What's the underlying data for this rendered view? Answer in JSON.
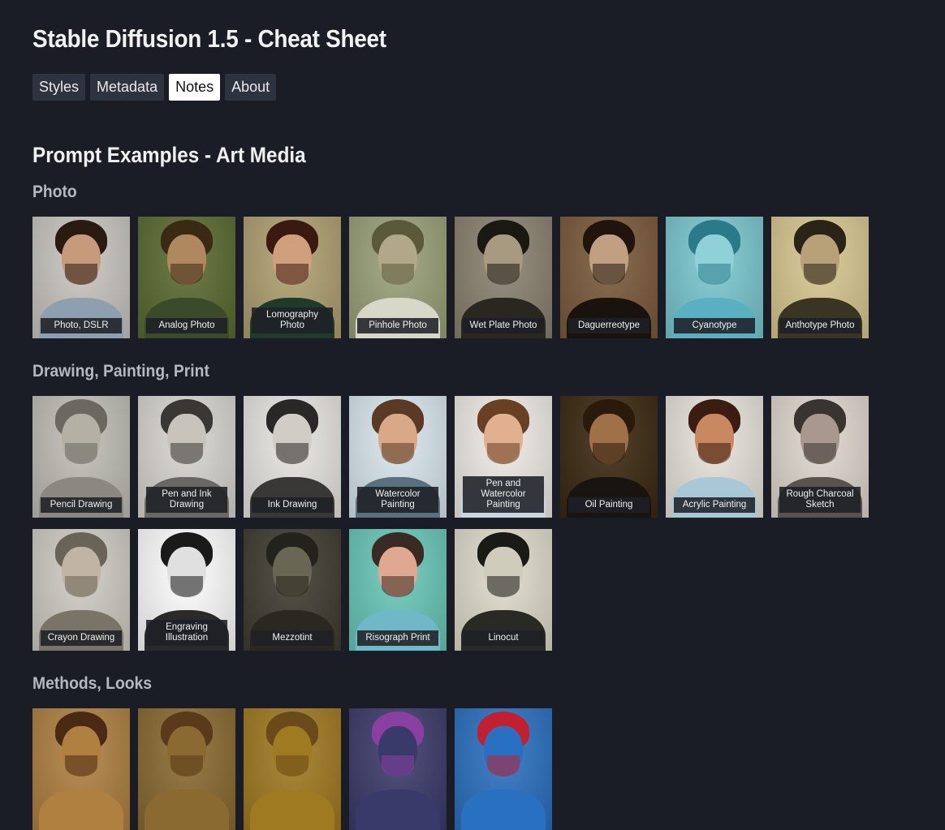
{
  "title": "Stable Diffusion 1.5 - Cheat Sheet",
  "tabs": [
    {
      "label": "Styles",
      "active": false
    },
    {
      "label": "Metadata",
      "active": false
    },
    {
      "label": "Notes",
      "active": true
    },
    {
      "label": "About",
      "active": false
    }
  ],
  "section_title": "Prompt Examples - Art Media",
  "categories": [
    {
      "title": "Photo",
      "items": [
        {
          "label": "Photo, DSLR",
          "bg": "#c9c6c0",
          "hair": "#2a1a10",
          "face": "#c79a7c",
          "torso": "#8ea0b0"
        },
        {
          "label": "Analog Photo",
          "bg": "#5a6a30",
          "hair": "#3a2a14",
          "face": "#b08860",
          "torso": "#3b4a28"
        },
        {
          "label": "Lomography Photo",
          "bg": "#b0a070",
          "hair": "#3a1a10",
          "face": "#d0a07c",
          "torso": "#1e3a28"
        },
        {
          "label": "Pinhole Photo",
          "bg": "#9aa078",
          "hair": "#5a5a3a",
          "face": "#b0a888",
          "torso": "#d8d8c8"
        },
        {
          "label": "Wet Plate Photo",
          "bg": "#8a8270",
          "hair": "#1a1812",
          "face": "#a89a80",
          "torso": "#2a2620"
        },
        {
          "label": "Daguerreotype",
          "bg": "#7a5a3a",
          "hair": "#20140c",
          "face": "#c0a080",
          "torso": "#1a120c"
        },
        {
          "label": "Cyanotype",
          "bg": "#7ac8d0",
          "hair": "#2a7a8a",
          "face": "#90d0d8",
          "torso": "#5ab0c0"
        },
        {
          "label": "Anthotype Photo",
          "bg": "#d8c890",
          "hair": "#2a2418",
          "face": "#b8a078",
          "torso": "#3a3424"
        }
      ]
    },
    {
      "title": "Drawing, Painting, Print",
      "items": [
        {
          "label": "Pencil Drawing",
          "bg": "#c0beb6",
          "hair": "#6a6860",
          "face": "#b4b0a6",
          "torso": "#8a8880"
        },
        {
          "label": "Pen and Ink Drawing",
          "bg": "#d8d6d0",
          "hair": "#3a3834",
          "face": "#c8c4bc",
          "torso": "#6a6864"
        },
        {
          "label": "Ink Drawing",
          "bg": "#e8e6e2",
          "hair": "#2a2826",
          "face": "#d0ccc6",
          "torso": "#3a3836"
        },
        {
          "label": "Watercolor Painting",
          "bg": "#dae8ee",
          "hair": "#5a3a24",
          "face": "#d8a888",
          "torso": "#5a7080"
        },
        {
          "label": "Pen and Watercolor Painting",
          "bg": "#f0ece6",
          "hair": "#6a4024",
          "face": "#e0b090",
          "torso": "#c8d8e0"
        },
        {
          "label": "Oil Painting",
          "bg": "#3a2810",
          "hair": "#2a1a0c",
          "face": "#a07048",
          "torso": "#1a1410"
        },
        {
          "label": "Acrylic Painting",
          "bg": "#e8e4dc",
          "hair": "#3a1c10",
          "face": "#c88860",
          "torso": "#a8c8d8"
        },
        {
          "label": "Rough Charcoal Sketch",
          "bg": "#e0d8d0",
          "hair": "#3a3430",
          "face": "#a89890",
          "torso": "#5a524c"
        }
      ]
    },
    {
      "title": "",
      "items": [
        {
          "label": "Crayon Drawing",
          "bg": "#d0ccc4",
          "hair": "#6a6458",
          "face": "#c0b4a4",
          "torso": "#7a7468"
        },
        {
          "label": "Engraving Illustration",
          "bg": "#ffffff",
          "hair": "#1a1a1a",
          "face": "#e0e0e0",
          "torso": "#2a2a2a"
        },
        {
          "label": "Mezzotint",
          "bg": "#3e3c30",
          "hair": "#24221c",
          "face": "#6a6654",
          "torso": "#2a2820"
        },
        {
          "label": "Risograph Print",
          "bg": "#68c8b8",
          "hair": "#3a2a24",
          "face": "#e0a890",
          "torso": "#70b8c8"
        },
        {
          "label": "Linocut",
          "bg": "#e0dccc",
          "hair": "#1a1a16",
          "face": "#d0ccbc",
          "torso": "#2a2a24"
        }
      ]
    },
    {
      "title": "Methods, Looks",
      "items": [
        {
          "label": "",
          "bg": "#b08040",
          "hair": "#4a2a14",
          "face": "#b08040",
          "torso": "#b08040"
        },
        {
          "label": "",
          "bg": "#8a6a30",
          "hair": "#5a3a1a",
          "face": "#8a6a30",
          "torso": "#8a6a30"
        },
        {
          "label": "",
          "bg": "#a07a20",
          "hair": "#6a4a1a",
          "face": "#a07a20",
          "torso": "#a07a20"
        },
        {
          "label": "",
          "bg": "#3a3a6a",
          "hair": "#8a40a0",
          "face": "#3a3a6a",
          "torso": "#3a3a6a"
        },
        {
          "label": "",
          "bg": "#2a70c0",
          "hair": "#c02030",
          "face": "#2a70c0",
          "torso": "#2a70c0"
        }
      ]
    }
  ]
}
